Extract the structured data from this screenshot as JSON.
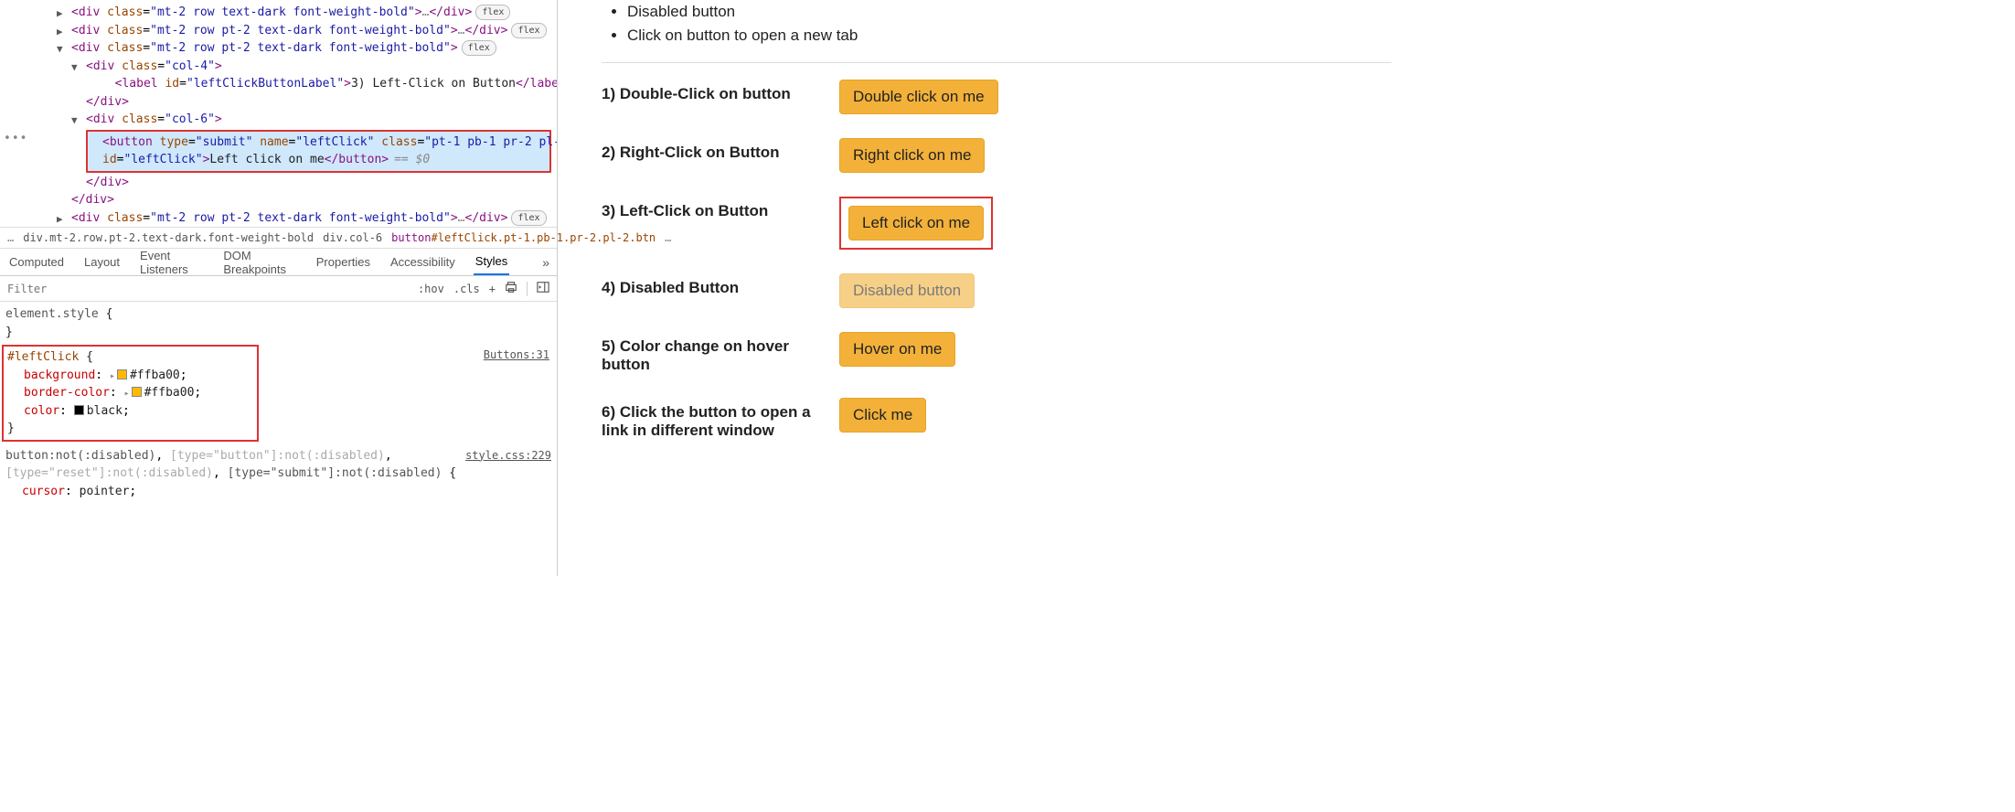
{
  "dom": {
    "row1": {
      "class": "mt-2 row text-dark font-weight-bold",
      "badge": "flex"
    },
    "row2": {
      "class": "mt-2 row pt-2 text-dark font-weight-bold",
      "badge": "flex"
    },
    "row3": {
      "class": "mt-2 row pt-2 text-dark font-weight-bold",
      "badge": "flex"
    },
    "col4": {
      "class": "col-4"
    },
    "label": {
      "id": "leftClickButtonLabel",
      "text": "3) Left-Click on Button"
    },
    "col6": {
      "class": "col-6"
    },
    "button": {
      "type": "submit",
      "name_attr": "leftClick",
      "class": "pt-1 pb-1 pr-2 pl-2 btn",
      "id": "leftClick",
      "text": "Left click on me",
      "eq": "== $0"
    },
    "row4": {
      "class": "mt-2 row pt-2 text-dark font-weight-bold",
      "badge": "flex"
    }
  },
  "breadcrumb": {
    "more1": "…",
    "item1": "div.mt-2.row.pt-2.text-dark.font-weight-bold",
    "item2": "div.col-6",
    "item3_tag": "button",
    "item3_rest": "#leftClick.pt-1.pb-1.pr-2.pl-2.btn",
    "more2": "…"
  },
  "tabs": {
    "computed": "Computed",
    "layout": "Layout",
    "listeners": "Event Listeners",
    "dombp": "DOM Breakpoints",
    "props": "Properties",
    "a11y": "Accessibility",
    "styles": "Styles"
  },
  "toolbar": {
    "filter_ph": "Filter",
    "hov": ":hov",
    "cls": ".cls",
    "plus": "+"
  },
  "styles": {
    "elem_sel": "element.style",
    "rule1": {
      "selector": "#leftClick",
      "src": "Buttons:31",
      "d1p": "background",
      "d1v": "#ffba00",
      "d2p": "border-color",
      "d2v": "#ffba00",
      "d3p": "color",
      "d3v": "black"
    },
    "rule2": {
      "sel_a": "button:not(:disabled)",
      "sel_b": "[type=\"button\"]:not(:disabled)",
      "sel_c": "[type=\"reset\"]:not(:disabled)",
      "sel_d": "[type=\"submit\"]:not(:disabled)",
      "src": "style.css:229",
      "d1p": "cursor",
      "d1v": "pointer"
    }
  },
  "page": {
    "li1": "Disabled button",
    "li2": "Click on button to open a new tab",
    "rows": [
      {
        "label": "1) Double-Click on button",
        "btn": "Double click on me"
      },
      {
        "label": "2) Right-Click on Button",
        "btn": "Right click on me"
      },
      {
        "label": "3) Left-Click on Button",
        "btn": "Left click on me"
      },
      {
        "label": "4) Disabled Button",
        "btn": "Disabled button"
      },
      {
        "label": "5) Color change on hover button",
        "btn": "Hover on me"
      },
      {
        "label": "6) Click the button to open a link in different window",
        "btn": "Click me"
      }
    ]
  }
}
